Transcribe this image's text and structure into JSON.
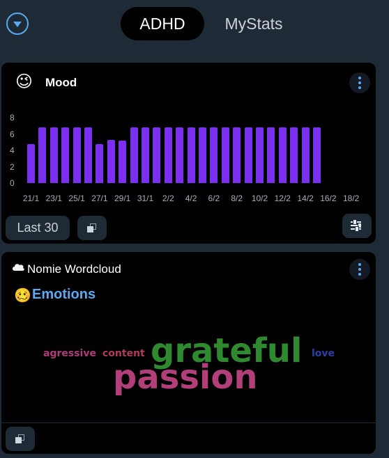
{
  "header": {
    "tabs": [
      {
        "label": "ADHD",
        "active": true
      },
      {
        "label": "MyStats",
        "active": false
      }
    ],
    "menu_icon": "chevron-down-circle-icon"
  },
  "mood_card": {
    "title": "Mood",
    "emoji": "😉",
    "range_button": "Last 30",
    "icons": [
      "copy-icon",
      "sliders-icon",
      "more-vertical-icon"
    ],
    "chart_data": {
      "type": "bar",
      "x_tick_labels": [
        "21/1",
        "23/1",
        "25/1",
        "27/1",
        "29/1",
        "31/1",
        "2/2",
        "4/2",
        "6/2",
        "8/2",
        "10/2",
        "12/2",
        "14/2",
        "16/2",
        "18/2"
      ],
      "y_tick_labels": [
        "8",
        "6",
        "4",
        "2",
        "0"
      ],
      "ylim": [
        0,
        8
      ],
      "bar_color": "#7b2ff0",
      "values": [
        4.8,
        6.8,
        6.8,
        6.8,
        6.8,
        6.8,
        4.8,
        5.3,
        5.2,
        6.8,
        6.8,
        6.8,
        6.8,
        6.8,
        6.8,
        6.8,
        6.8,
        6.8,
        6.8,
        6.8,
        6.8,
        6.8,
        6.8,
        6.8,
        6.8,
        6.8
      ],
      "legend": "none",
      "grid": false
    }
  },
  "wordcloud_card": {
    "title": "Nomie Wordcloud",
    "title_icon": "cloud-icon",
    "section_emoji": "🥴",
    "section_label": "Emotions",
    "words": [
      {
        "text": "agressive",
        "color": "#b03a7a",
        "weight": 1
      },
      {
        "text": "content",
        "color": "#b03a5a",
        "weight": 1
      },
      {
        "text": "grateful",
        "color": "#2f8a2f",
        "weight": 4
      },
      {
        "text": "love",
        "color": "#2b3fa6",
        "weight": 1
      },
      {
        "text": "passion",
        "color": "#b23f79",
        "weight": 4
      }
    ],
    "icons": [
      "copy-icon",
      "more-vertical-icon"
    ]
  }
}
